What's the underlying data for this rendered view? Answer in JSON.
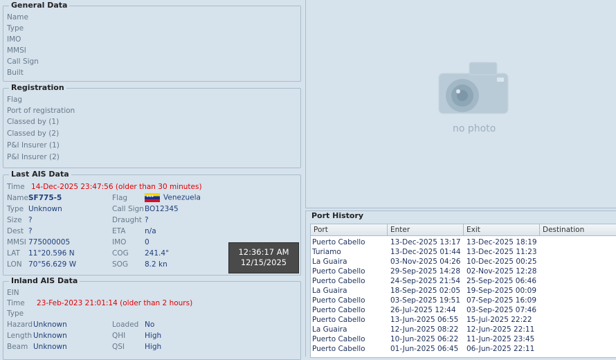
{
  "general": {
    "title": "General Data",
    "labels": [
      "Name",
      "Type",
      "IMO",
      "MMSI",
      "Call Sign",
      "Built"
    ]
  },
  "registration": {
    "title": "Registration",
    "labels": [
      "Flag",
      "Port of registration",
      "Classed by (1)",
      "Classed by (2)",
      "P&I Insurer (1)",
      "P&I Insurer (2)"
    ]
  },
  "ais": {
    "title": "Last AIS Data",
    "time_label": "Time",
    "time_value": "14-Dec-2025 23:47:56 (older than 30 minutes)",
    "name_label": "Name",
    "name_value": "SF775-5",
    "flag_label": "Flag",
    "flag_value": "Venezuela",
    "type_label": "Type",
    "type_value": "Unknown",
    "callsign_label": "Call Sign",
    "callsign_value": "BO12345",
    "size_label": "Size",
    "size_value": "?",
    "draught_label": "Draught",
    "draught_value": "?",
    "dest_label": "Dest",
    "dest_value": "?",
    "eta_label": "ETA",
    "eta_value": "n/a",
    "mmsi_label": "MMSI",
    "mmsi_value": "775000005",
    "imo_label": "IMO",
    "imo_value": "0",
    "lat_label": "LAT",
    "lat_value": "11°20.596 N",
    "cog_label": "COG",
    "cog_value": "241.4°",
    "lon_label": "LON",
    "lon_value": "70°56.629 W",
    "sog_label": "SOG",
    "sog_value": "8.2 kn"
  },
  "clock": {
    "time": "12:36:17 AM",
    "date": "12/15/2025"
  },
  "inland": {
    "title": "Inland AIS Data",
    "ein_label": "EIN",
    "time_label": "Time",
    "time_value": "23-Feb-2023 21:01:14 (older than 2 hours)",
    "type_label": "Type",
    "hazard_label": "Hazard",
    "hazard_value": "Unknown",
    "loaded_label": "Loaded",
    "loaded_value": "No",
    "length_label": "Length",
    "length_value": "Unknown",
    "qhi_label": "QHI",
    "qhi_value": "High",
    "beam_label": "Beam",
    "beam_value": "Unknown",
    "qsi_label": "QSI",
    "qsi_value": "High"
  },
  "photo": {
    "placeholder": "no photo"
  },
  "port_history": {
    "title": "Port History",
    "columns": [
      "Port",
      "Enter",
      "Exit",
      "Destination"
    ],
    "rows": [
      [
        "Puerto Cabello",
        "13-Dec-2025 13:17",
        "13-Dec-2025 18:19",
        ""
      ],
      [
        "Turiamo",
        "13-Dec-2025 01:44",
        "13-Dec-2025 11:23",
        ""
      ],
      [
        "La Guaira",
        "03-Nov-2025 04:26",
        "10-Dec-2025 00:25",
        ""
      ],
      [
        "Puerto Cabello",
        "29-Sep-2025 14:28",
        "02-Nov-2025 12:28",
        ""
      ],
      [
        "Puerto Cabello",
        "24-Sep-2025 21:54",
        "25-Sep-2025 06:46",
        ""
      ],
      [
        "La Guaira",
        "18-Sep-2025 02:05",
        "19-Sep-2025 00:09",
        ""
      ],
      [
        "Puerto Cabello",
        "03-Sep-2025 19:51",
        "07-Sep-2025 16:09",
        ""
      ],
      [
        "Puerto Cabello",
        "26-Jul-2025 12:44",
        "03-Sep-2025 07:46",
        ""
      ],
      [
        "Puerto Cabello",
        "13-Jun-2025 06:55",
        "15-Jul-2025 22:22",
        ""
      ],
      [
        "La Guaira",
        "12-Jun-2025 08:22",
        "12-Jun-2025 22:11",
        ""
      ],
      [
        "Puerto Cabello",
        "10-Jun-2025 06:22",
        "11-Jun-2025 23:45",
        ""
      ],
      [
        "Puerto Cabello",
        "01-Jun-2025 06:45",
        "06-Jun-2025 22:11",
        ""
      ]
    ]
  }
}
